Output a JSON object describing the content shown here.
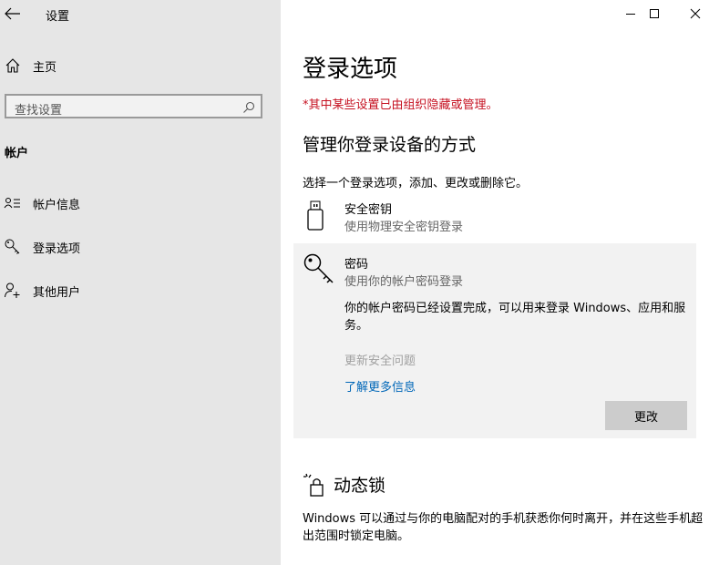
{
  "app": {
    "title": "设置"
  },
  "sidebar": {
    "home_label": "主页",
    "search_placeholder": "查找设置",
    "section_heading": "帐户",
    "items": [
      {
        "label": "帐户信息",
        "icon": "account-info-icon"
      },
      {
        "label": "登录选项",
        "icon": "key-icon"
      },
      {
        "label": "其他用户",
        "icon": "add-user-icon"
      }
    ]
  },
  "main": {
    "title": "登录选项",
    "warning": "*其中某些设置已由组织隐藏或管理。",
    "manage_heading": "管理你登录设备的方式",
    "manage_desc": "选择一个登录选项，添加、更改或删除它。",
    "options": {
      "security_key": {
        "title": "安全密钥",
        "subtitle": "使用物理安全密钥登录",
        "icon": "usb-key-icon"
      },
      "password": {
        "title": "密码",
        "subtitle": "使用你的帐户密码登录",
        "icon": "key-icon",
        "detail": "你的帐户密码已经设置完成，可以用来登录 Windows、应用和服务。",
        "update_questions": "更新安全问题",
        "learn_more": "了解更多信息",
        "change_button": "更改"
      }
    },
    "dynamic_lock": {
      "title": "动态锁",
      "icon": "dynamic-lock-icon",
      "desc": "Windows 可以通过与你的电脑配对的手机获悉你何时离开，并在这些手机超出范围时锁定电脑。"
    }
  },
  "colors": {
    "warning": "#c50f1f",
    "link": "#0067b8",
    "sidebar_bg": "#e6e6e6",
    "panel_bg": "#f2f2f2"
  }
}
